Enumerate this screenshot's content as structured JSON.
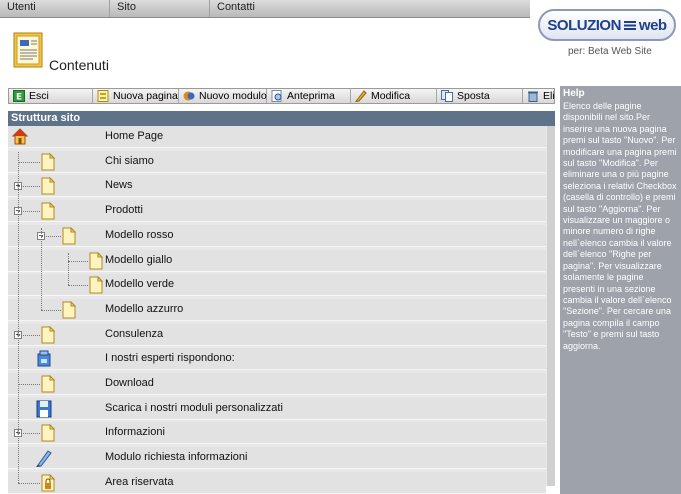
{
  "top_menu": [
    {
      "label": "Utenti"
    },
    {
      "label": "Sito"
    },
    {
      "label": "Contatti"
    }
  ],
  "logo": {
    "text_left": "SOLUZION",
    "text_right": "web",
    "subtitle": "per: Beta Web Site"
  },
  "page": {
    "title": "Contenuti"
  },
  "toolbar": [
    {
      "label": "Esci",
      "icon": "exit-icon"
    },
    {
      "label": "Nuova pagina",
      "icon": "new-page-icon"
    },
    {
      "label": "Nuovo modulo",
      "icon": "new-module-icon"
    },
    {
      "label": "Anteprima",
      "icon": "preview-icon"
    },
    {
      "label": "Modifica",
      "icon": "edit-pencil-icon"
    },
    {
      "label": "Sposta",
      "icon": "move-icon"
    },
    {
      "label": "Eli",
      "icon": "trash-icon"
    }
  ],
  "structure": {
    "header": "Struttura sito",
    "rows": [
      {
        "label": "Home Page",
        "icon": "home-icon"
      },
      {
        "label": "Chi siamo",
        "icon": "page-icon"
      },
      {
        "label": "News",
        "icon": "page-icon"
      },
      {
        "label": "Prodotti",
        "icon": "page-icon"
      },
      {
        "label": "Modello rosso",
        "icon": "page-icon"
      },
      {
        "label": "Modello giallo",
        "icon": "page-icon"
      },
      {
        "label": "Modello verde",
        "icon": "page-icon"
      },
      {
        "label": "Modello azzurro",
        "icon": "page-icon"
      },
      {
        "label": "Consulenza",
        "icon": "page-icon"
      },
      {
        "label": "I nostri esperti rispondono:",
        "icon": "module-icon"
      },
      {
        "label": "Download",
        "icon": "page-icon"
      },
      {
        "label": "Scarica i nostri moduli personalizzati",
        "icon": "floppy-icon"
      },
      {
        "label": "Informazioni",
        "icon": "page-icon"
      },
      {
        "label": "Modulo richiesta informazioni",
        "icon": "pencil-icon"
      },
      {
        "label": "Area riservata",
        "icon": "locked-page-icon"
      }
    ]
  },
  "help": {
    "title": "Help",
    "text": "Elenco delle pagine disponibili nel sito.Per inserire una nuova pagina premi sul tasto \"Nuovo\". Per modificare una pagina premi sul tasto \"Modifica\". Per eliminare una o più pagine seleziona i relativi Checkbox (casella di controllo) e premi sul tasto \"Aggiorna\". Per visualizzare un maggiore o minore numero di righe nell`elenco cambia il valore dell`elenco \"Righe per pagina\". Per visualizzare solamente le pagine presenti in una sezione cambia il valore dell`elenco \"Sezione\". Per cercare una pagina compila il campo \"Testo\" e premi sul tasto aggiorna."
  }
}
